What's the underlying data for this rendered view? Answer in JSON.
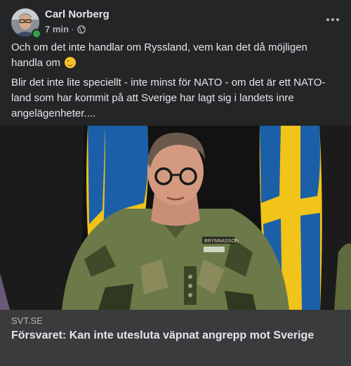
{
  "post": {
    "author": "Carl Norberg",
    "time": "7 min",
    "privacy_icon": "globe-icon",
    "more_icon": "more-options-icon",
    "text_p1": "Och om det inte handlar om Ryssland, vem kan det då möjligen handla om",
    "emoji": "wink-emoji",
    "text_p2": "Blir det inte lite speciellt - inte minst för NATO - om det är ett NATO-land som har kommit på att Sverige har lagt sig i landets inre angelägenheter...."
  },
  "link": {
    "domain": "SVT.SE",
    "title": "Försvaret: Kan inte utesluta väpnat angrepp mot Sverige",
    "name_tag": "BRYNNASSON"
  },
  "colors": {
    "background": "#242526",
    "link_card": "#3a3b3c",
    "text_primary": "#e4e6eb",
    "text_secondary": "#b0b3b8",
    "online": "#31a24c",
    "flag_blue": "#1b5fa8",
    "flag_yellow": "#f2c318"
  }
}
